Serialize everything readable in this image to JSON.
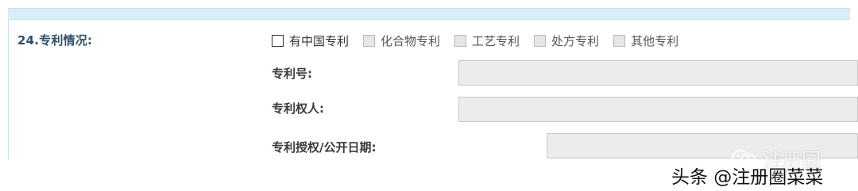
{
  "form": {
    "section_label": "24.专利情况:",
    "options": [
      {
        "label": "有中国专利",
        "checked": false,
        "disabled": false
      },
      {
        "label": "化合物专利",
        "checked": false,
        "disabled": true
      },
      {
        "label": "工艺专利",
        "checked": false,
        "disabled": true
      },
      {
        "label": "处方专利",
        "checked": false,
        "disabled": true
      },
      {
        "label": "其他专利",
        "checked": false,
        "disabled": true
      }
    ],
    "fields": [
      {
        "label": "专利号:",
        "value": ""
      },
      {
        "label": "专利权人:",
        "value": ""
      },
      {
        "label": "专利授权/公开日期:",
        "value": ""
      }
    ]
  },
  "watermark": {
    "logo_text": "注册圈",
    "handle_text": "头条 @注册圈菜菜"
  },
  "colors": {
    "header_bar": "#d9eef6",
    "label_blue": "#2f4f67",
    "input_bg": "#ececec"
  }
}
